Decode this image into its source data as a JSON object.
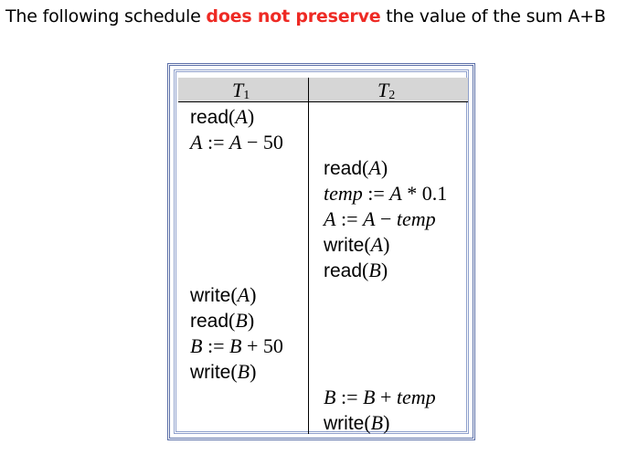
{
  "heading": {
    "before": "The following schedule ",
    "emphasis": "does not preserve",
    "after": " the value of the sum A+B"
  },
  "colors": {
    "emphasis": "#ee2a24",
    "frame": "#5b6fa8",
    "header_band": "#d6d6d6"
  },
  "schedule": {
    "columns": [
      {
        "name": "T",
        "subscript": "1"
      },
      {
        "name": "T",
        "subscript": "2"
      }
    ],
    "t1": {
      "read_a": {
        "fn": "read",
        "open": "(",
        "arg": "A",
        "close": ")"
      },
      "assign_a": {
        "lhs": "A",
        "op": " := ",
        "var": "A",
        "minus": " − ",
        "num": "50"
      },
      "write_a": {
        "fn": "write",
        "open": "(",
        "arg": "A",
        "close": ")"
      },
      "read_b": {
        "fn": "read",
        "open": "(",
        "arg": "B",
        "close": ")"
      },
      "assign_b": {
        "lhs": "B",
        "op": " := ",
        "var": "B",
        "plus": " + ",
        "num": "50"
      },
      "write_b": {
        "fn": "write",
        "open": "(",
        "arg": "B",
        "close": ")"
      }
    },
    "t2": {
      "read_a": {
        "fn": "read",
        "open": "(",
        "arg": "A",
        "close": ")"
      },
      "assign_temp": {
        "lhs": "temp",
        "op": " := ",
        "var": "A",
        "times": " * ",
        "num": "0.1"
      },
      "assign_a": {
        "lhs": "A",
        "op": " := ",
        "var": "A",
        "minus": " − ",
        "rhs": "temp"
      },
      "write_a": {
        "fn": "write",
        "open": "(",
        "arg": "A",
        "close": ")"
      },
      "read_b": {
        "fn": "read",
        "open": "(",
        "arg": "B",
        "close": ")"
      },
      "assign_b": {
        "lhs": "B",
        "op": " := ",
        "var": "B",
        "plus": " + ",
        "rhs": "temp"
      },
      "write_b": {
        "fn": "write",
        "open": "(",
        "arg": "B",
        "close": ")"
      }
    }
  }
}
